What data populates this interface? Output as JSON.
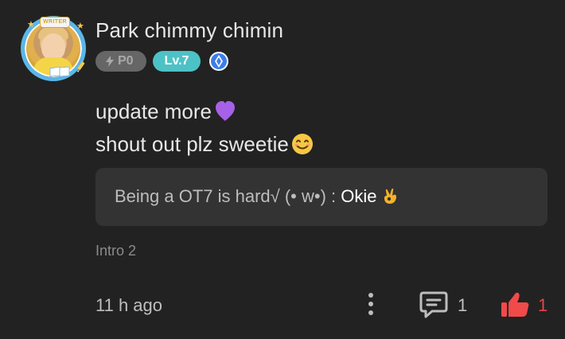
{
  "post": {
    "author": {
      "name": "Park chimmy chimin",
      "avatar_badge": "WRITER",
      "points_badge": "P0",
      "level_badge": "Lv.7"
    },
    "content_lines": [
      "update more",
      "shout out plz sweetie"
    ],
    "quote": {
      "text_prefix": "Being a OT7 is hard√ (• w•) : ",
      "text_highlight": "Okie"
    },
    "tag": "Intro 2",
    "time": "11 h ago",
    "actions": {
      "comments_count": "1",
      "likes_count": "1"
    }
  },
  "icons": {
    "avatar_ring": "#59b7e9",
    "level_badge_bg": "#4dc2c6",
    "like_color": "#f04a4a"
  }
}
